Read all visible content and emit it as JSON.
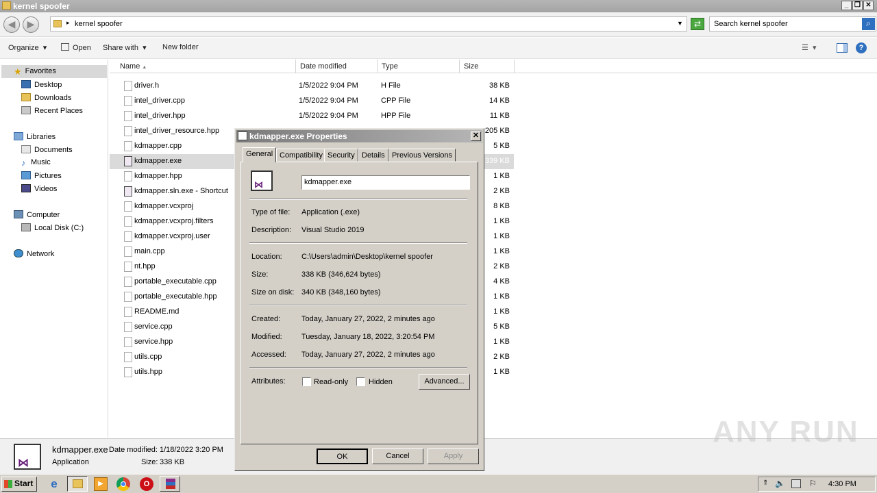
{
  "window": {
    "title": "kernel spoofer"
  },
  "address": {
    "folder": "kernel spoofer",
    "search_placeholder": "Search kernel spoofer"
  },
  "toolbar": {
    "organize": "Organize",
    "open": "Open",
    "share_with": "Share with",
    "new_folder": "New folder"
  },
  "nav": {
    "favorites": "Favorites",
    "desktop": "Desktop",
    "downloads": "Downloads",
    "recent_places": "Recent Places",
    "libraries": "Libraries",
    "documents": "Documents",
    "music": "Music",
    "pictures": "Pictures",
    "videos": "Videos",
    "computer": "Computer",
    "local_disk": "Local Disk (C:)",
    "network": "Network"
  },
  "columns": {
    "name": "Name",
    "date": "Date modified",
    "type": "Type",
    "size": "Size"
  },
  "files": [
    {
      "name": "driver.h",
      "date": "1/5/2022 9:04 PM",
      "type": "H File",
      "size": "38 KB"
    },
    {
      "name": "intel_driver.cpp",
      "date": "1/5/2022 9:04 PM",
      "type": "CPP File",
      "size": "14 KB"
    },
    {
      "name": "intel_driver.hpp",
      "date": "1/5/2022 9:04 PM",
      "type": "HPP File",
      "size": "11 KB"
    },
    {
      "name": "intel_driver_resource.hpp",
      "date": "",
      "type": "",
      "size": "205 KB"
    },
    {
      "name": "kdmapper.cpp",
      "date": "",
      "type": "",
      "size": "5 KB"
    },
    {
      "name": "kdmapper.exe",
      "date": "",
      "type": "",
      "size": "339 KB"
    },
    {
      "name": "kdmapper.hpp",
      "date": "",
      "type": "",
      "size": "1 KB"
    },
    {
      "name": "kdmapper.sln.exe - Shortcut",
      "date": "",
      "type": "",
      "size": "2 KB"
    },
    {
      "name": "kdmapper.vcxproj",
      "date": "",
      "type": "",
      "size": "8 KB"
    },
    {
      "name": "kdmapper.vcxproj.filters",
      "date": "",
      "type": "",
      "size": "1 KB"
    },
    {
      "name": "kdmapper.vcxproj.user",
      "date": "",
      "type": "",
      "size": "1 KB"
    },
    {
      "name": "main.cpp",
      "date": "",
      "type": "",
      "size": "1 KB"
    },
    {
      "name": "nt.hpp",
      "date": "",
      "type": "",
      "size": "2 KB"
    },
    {
      "name": "portable_executable.cpp",
      "date": "",
      "type": "",
      "size": "4 KB"
    },
    {
      "name": "portable_executable.hpp",
      "date": "",
      "type": "",
      "size": "1 KB"
    },
    {
      "name": "README.md",
      "date": "",
      "type": "",
      "size": "1 KB"
    },
    {
      "name": "service.cpp",
      "date": "",
      "type": "",
      "size": "5 KB"
    },
    {
      "name": "service.hpp",
      "date": "",
      "type": "",
      "size": "1 KB"
    },
    {
      "name": "utils.cpp",
      "date": "",
      "type": "",
      "size": "2 KB"
    },
    {
      "name": "utils.hpp",
      "date": "",
      "type": "",
      "size": "1 KB"
    }
  ],
  "statusbar": {
    "name": "kdmapper.exe",
    "date_label": "Date modified:",
    "date_value": "1/18/2022 3:20 PM",
    "type": "Application",
    "size_label": "Size:",
    "size_value": "338 KB"
  },
  "dialog": {
    "title": "kdmapper.exe Properties",
    "tabs": [
      "General",
      "Compatibility",
      "Security",
      "Details",
      "Previous Versions"
    ],
    "filename": "kdmapper.exe",
    "type_label": "Type of file:",
    "type_value": "Application (.exe)",
    "desc_label": "Description:",
    "desc_value": "Visual Studio 2019",
    "location_label": "Location:",
    "location_value": "C:\\Users\\admin\\Desktop\\kernel spoofer",
    "size_label": "Size:",
    "size_value": "338 KB (346,624 bytes)",
    "sizeondisk_label": "Size on disk:",
    "sizeondisk_value": "340 KB (348,160 bytes)",
    "created_label": "Created:",
    "created_value": "Today, January 27, 2022, 2 minutes ago",
    "modified_label": "Modified:",
    "modified_value": "Tuesday, January 18, 2022, 3:20:54 PM",
    "accessed_label": "Accessed:",
    "accessed_value": "Today, January 27, 2022, 2 minutes ago",
    "attributes_label": "Attributes:",
    "readonly_label": "Read-only",
    "hidden_label": "Hidden",
    "advanced_label": "Advanced...",
    "ok_label": "OK",
    "cancel_label": "Cancel",
    "apply_label": "Apply"
  },
  "taskbar": {
    "start": "Start",
    "clock": "4:30 PM"
  },
  "watermark": "ANY RUN"
}
